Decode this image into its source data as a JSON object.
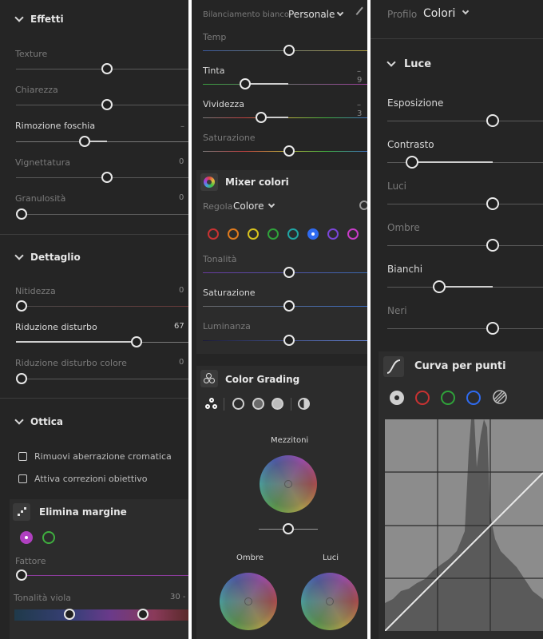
{
  "effetti": {
    "title": "Effetti",
    "sliders": [
      {
        "label": "Texture",
        "value": ""
      },
      {
        "label": "Chiarezza",
        "value": ""
      },
      {
        "label": "Rimozione foschia",
        "value": "–"
      },
      {
        "label": "Vignettatura",
        "value": "0"
      },
      {
        "label": "Granulosità",
        "value": "0"
      }
    ]
  },
  "dettaglio": {
    "title": "Dettaglio",
    "sliders": [
      {
        "label": "Nitidezza",
        "value": "0"
      },
      {
        "label": "Riduzione disturbo",
        "value": "67"
      },
      {
        "label": "Riduzione disturbo colore",
        "value": "0"
      }
    ]
  },
  "ottica": {
    "title": "Ottica",
    "checks": [
      "Rimuovi aberrazione cromatica",
      "Attiva correzioni obiettivo"
    ]
  },
  "elimina_margine": {
    "title": "Elimina margine",
    "fattore": "Fattore",
    "tonalita_viola": "Tonalità viola",
    "tonalita_value": "30 -"
  },
  "bilanciamento": {
    "label": "Bilanciamento bianco",
    "value": "Personale",
    "sliders": [
      {
        "label": "Temp",
        "value": ""
      },
      {
        "label": "Tinta",
        "value": "– 9"
      },
      {
        "label": "Vividezza",
        "value": "– 3"
      },
      {
        "label": "Saturazione",
        "value": ""
      }
    ]
  },
  "mixer": {
    "title": "Mixer colori",
    "regola_label": "Regola",
    "regola_value": "Colore",
    "swatch_colors": [
      "#c83232",
      "#e07a1e",
      "#d8c21e",
      "#2fa23a",
      "#1fa6a6",
      "#2f6bf0",
      "#7a45d8",
      "#c83cc8"
    ],
    "sliders": [
      {
        "label": "Tonalità"
      },
      {
        "label": "Saturazione"
      },
      {
        "label": "Luminanza"
      }
    ]
  },
  "color_grading": {
    "title": "Color Grading",
    "mezzitoni": "Mezzitoni",
    "ombre": "Ombre",
    "luci": "Luci"
  },
  "profilo": {
    "label": "Profilo",
    "value": "Colori"
  },
  "luce": {
    "title": "Luce",
    "sliders": [
      {
        "label": "Esposizione"
      },
      {
        "label": "Contrasto"
      },
      {
        "label": "Luci"
      },
      {
        "label": "Ombre"
      },
      {
        "label": "Bianchi"
      },
      {
        "label": "Neri"
      }
    ]
  },
  "curva": {
    "title": "Curva per punti",
    "channel_colors": [
      "#cfcfcf",
      "#c83232",
      "#2fa23a",
      "#2f6bf0"
    ]
  }
}
